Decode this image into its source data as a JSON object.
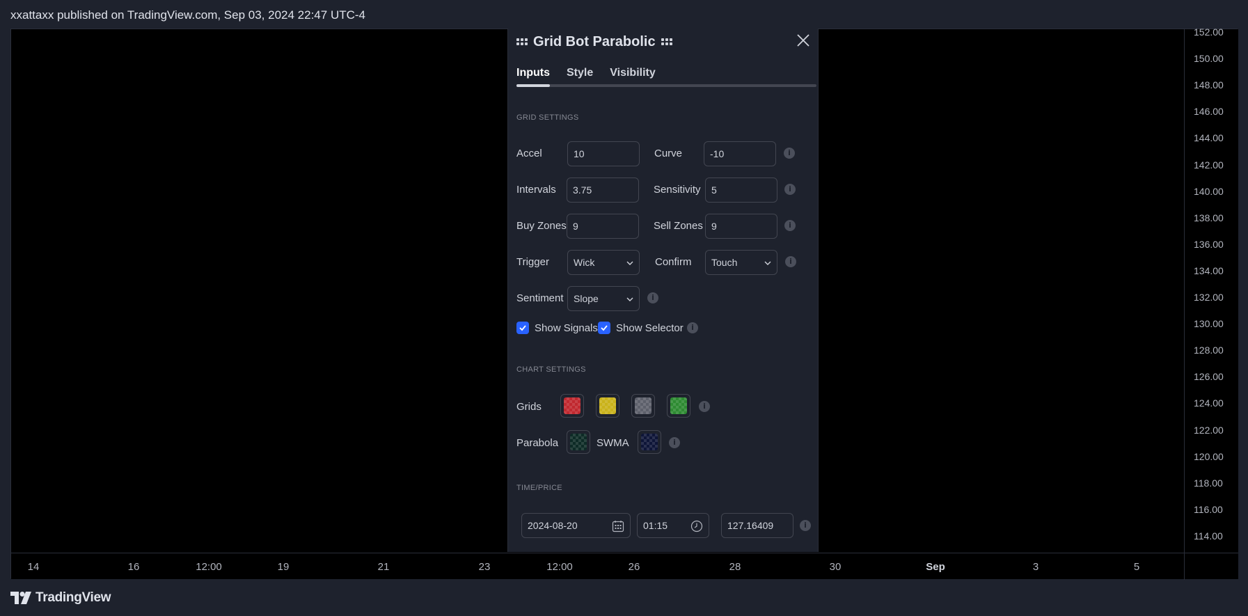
{
  "banner": {
    "text": "xxattaxx published on TradingView.com, Sep 03, 2024 22:47 UTC-4"
  },
  "price_axis": [
    "152.00",
    "150.00",
    "148.00",
    "146.00",
    "144.00",
    "142.00",
    "140.00",
    "138.00",
    "136.00",
    "134.00",
    "132.00",
    "130.00",
    "128.00",
    "126.00",
    "124.00",
    "122.00",
    "120.00",
    "118.00",
    "116.00",
    "114.00"
  ],
  "time_axis": [
    {
      "label": "14",
      "bold": false
    },
    {
      "label": "16",
      "bold": false
    },
    {
      "label": "12:00",
      "bold": false
    },
    {
      "label": "19",
      "bold": false
    },
    {
      "label": "21",
      "bold": false
    },
    {
      "label": "23",
      "bold": false
    },
    {
      "label": "12:00",
      "bold": false
    },
    {
      "label": "26",
      "bold": false
    },
    {
      "label": "28",
      "bold": false
    },
    {
      "label": "30",
      "bold": false
    },
    {
      "label": "Sep",
      "bold": true
    },
    {
      "label": "3",
      "bold": false
    },
    {
      "label": "5",
      "bold": false
    }
  ],
  "footer": {
    "brand": "TradingView"
  },
  "dialog": {
    "title": "Grid Bot Parabolic",
    "tabs": [
      "Inputs",
      "Style",
      "Visibility"
    ],
    "active_tab": "Inputs",
    "grid_settings": {
      "section": "GRID SETTINGS",
      "accel_label": "Accel",
      "accel_value": "10",
      "curve_label": "Curve",
      "curve_value": "-10",
      "intervals_label": "Intervals",
      "intervals_value": "3.75",
      "sensitivity_label": "Sensitivity",
      "sensitivity_value": "5",
      "buy_zones_label": "Buy Zones",
      "buy_zones_value": "9",
      "sell_zones_label": "Sell Zones",
      "sell_zones_value": "9",
      "trigger_label": "Trigger",
      "trigger_value": "Wick",
      "confirm_label": "Confirm",
      "confirm_value": "Touch",
      "sentiment_label": "Sentiment",
      "sentiment_value": "Slope",
      "show_signals_label": "Show Signals",
      "show_signals_checked": true,
      "show_selector_label": "Show Selector",
      "show_selector_checked": true
    },
    "chart_settings": {
      "section": "CHART SETTINGS",
      "grids_label": "Grids",
      "grid_colors": [
        "#c0282f",
        "#c9b21a",
        "#5d606b",
        "#2e8b32"
      ],
      "parabola_label": "Parabola",
      "parabola_color": "#0d2b26",
      "swma_label": "SWMA",
      "swma_color": "#0e1538"
    },
    "time_price": {
      "section": "TIME/PRICE",
      "date_value": "2024-08-20",
      "time_value": "01:15",
      "price_value": "127.16409"
    },
    "info_glyph": "i"
  }
}
